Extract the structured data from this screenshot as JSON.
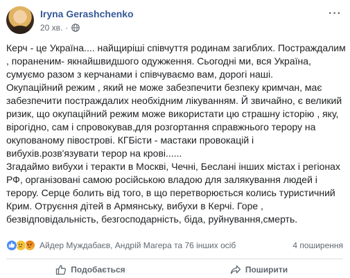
{
  "post": {
    "author": "Iryna Gerashchenko",
    "time": "20 хв.",
    "dot": "·",
    "audience_icon": "globe-icon",
    "more_icon": "ellipsis-icon",
    "more_label": "···",
    "lines": [
      "Керч - це Україна.... найщиріші співчуття родинам загиблих. Постраждалим",
      ", пораненим- якнайшвидшого одужження. Сьогодні ми, вся Україна,",
      "сумуємо разом з керчанами і співчуваємо вам, дорогі наші.",
      "Окупаційний режим , який не може забезпечити безпеку кримчан, має",
      "забезпечити постраждалих необхідним лікуванням. Й звичайно, є великий",
      "ризик, що окупаційний режим може використати цю страшну історію , яку,",
      "вірогідно, сам і спровокував,для розгортання справжнього терору на",
      "окупованому півострові. КГБісти - мастаки провокацій і",
      "вибухів.розв'язувати терор на крові......",
      "Згадаймо вибухи і теракти в Москві, Чечні, Беслані інших містах і регіонах",
      "РФ, організовані самою російською владою для залякування людей і",
      "терору. Серце болить від того, в що перетворюється колись туристичний",
      "Крим. Отруєння дітей в Армянську, вибухи в Керчі. Горе ,",
      "безвідповідальність, безгосподарність, біда, руйнування,смерть."
    ]
  },
  "reactions": {
    "icons": [
      "like-reaction-icon",
      "sad-reaction-icon",
      "angry-reaction-icon"
    ],
    "names": "Айдер Муждабаєв, Андрій Магера та 76 інших осіб",
    "shares": "4 поширення"
  },
  "actions": {
    "like_label": "Подобається",
    "share_label": "Поширити"
  },
  "colors": {
    "author": "#365899",
    "meta": "#616770",
    "like": "#4a8df6"
  }
}
